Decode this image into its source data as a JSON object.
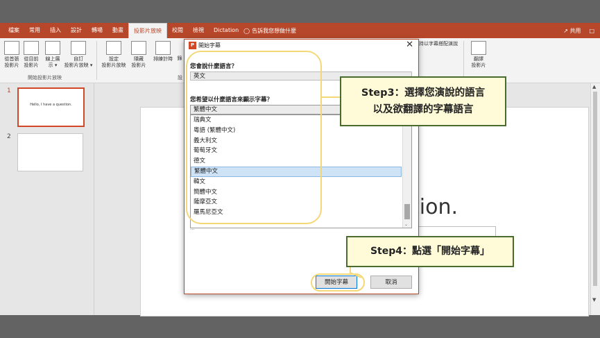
{
  "ribbon": {
    "tabs": [
      "檔案",
      "常用",
      "插入",
      "設計",
      "轉場",
      "動畫",
      "投影片放映",
      "校閱",
      "檢視",
      "Dictation"
    ],
    "active_tab": "投影片放映",
    "tell_me": "告訴我您想做什麼",
    "share": "共用",
    "buttons": {
      "from_beginning": "從首張\n投影片",
      "from_current": "從目前\n投影片",
      "present_online": "線上展\n示 ▾",
      "custom_show": "自訂\n投影片放映 ▾",
      "setup": "設定\n投影片放映",
      "hide": "隱藏\n投影片",
      "rehearse": "排練計時",
      "record_partial": "錄",
      "subtitle_setting_partial": "持以字幕搭配演說",
      "translate": "翻譯\n投影片"
    },
    "groups": {
      "start_show": "開始投影片放映",
      "setup_partial": "設"
    }
  },
  "thumbnails": {
    "slides": [
      {
        "num": "1",
        "text": "Hello, I have a question."
      },
      {
        "num": "2",
        "text": ""
      }
    ]
  },
  "slide": {
    "visible_text": "tion."
  },
  "dialog": {
    "title": "開始字幕",
    "close": "✕",
    "spoken_question": "您會說什麼語言？",
    "spoken_value": "英文",
    "subtitle_question": "您希望以什麼語言來顯示字幕？",
    "subtitle_value": "繁體中文",
    "options": [
      "瑞典文",
      "粵語 (繁體中文)",
      "義大利文",
      "葡萄牙文",
      "德文",
      "繁體中文",
      "韓文",
      "簡體中文",
      "薩摩亞文",
      "羅馬尼亞文"
    ],
    "highlighted_option": "繁體中文",
    "below_text": "...",
    "start_button": "開始字幕",
    "cancel_button": "取消"
  },
  "annotations": {
    "step3_line1": "Step3：選擇您演說的語言",
    "step3_line2": "以及欲翻譯的字幕語言",
    "step4": "Step4：點選「開始字幕」"
  },
  "colors": {
    "brand": "#b7472a",
    "highlight_yellow": "#f4d878",
    "callout_border": "#4a6b2e",
    "callout_fill": "#fffbd9"
  }
}
